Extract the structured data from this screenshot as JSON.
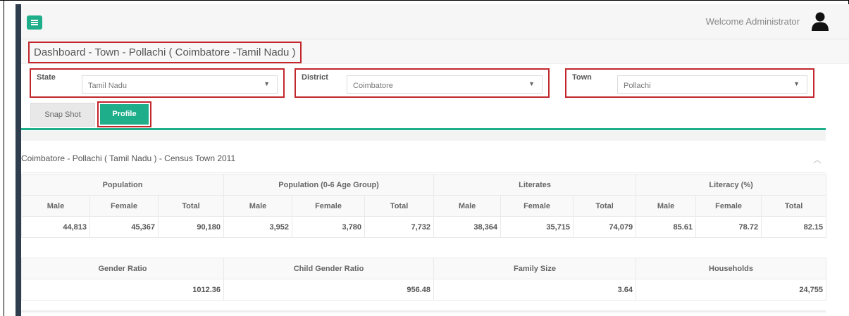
{
  "header": {
    "welcome_text": "Welcome Administrator",
    "menu_icon": "hamburger-icon",
    "user_icon": "user-silhouette-icon"
  },
  "page_title": "Dashboard - Town - Pollachi ( Coimbatore -Tamil Nadu )",
  "filters": [
    {
      "label": "State",
      "value": "Tamil Nadu"
    },
    {
      "label": "District",
      "value": "Coimbatore"
    },
    {
      "label": "Town",
      "value": "Pollachi"
    }
  ],
  "tabs": [
    {
      "label": "Snap Shot",
      "active": false
    },
    {
      "label": "Profile",
      "active": true
    }
  ],
  "panel": {
    "title": "Coimbatore - Pollachi ( Tamil Nadu ) - Census Town 2011"
  },
  "table1": {
    "groups": [
      "Population",
      "Population (0-6 Age Group)",
      "Literates",
      "Literacy (%)"
    ],
    "subheaders": [
      "Male",
      "Female",
      "Total"
    ],
    "values": [
      "44,813",
      "45,367",
      "90,180",
      "3,952",
      "3,780",
      "7,732",
      "38,364",
      "35,715",
      "74,079",
      "85.61",
      "78.72",
      "82.15"
    ]
  },
  "table2": {
    "headers": [
      "Gender Ratio",
      "Child Gender Ratio",
      "Family Size",
      "Households"
    ],
    "values": [
      "1012.36",
      "956.48",
      "3.64",
      "24,755"
    ]
  },
  "colors": {
    "accent": "#1fae8a",
    "highlight_border": "#c1272d",
    "sidebar": "#2f3e4e"
  }
}
